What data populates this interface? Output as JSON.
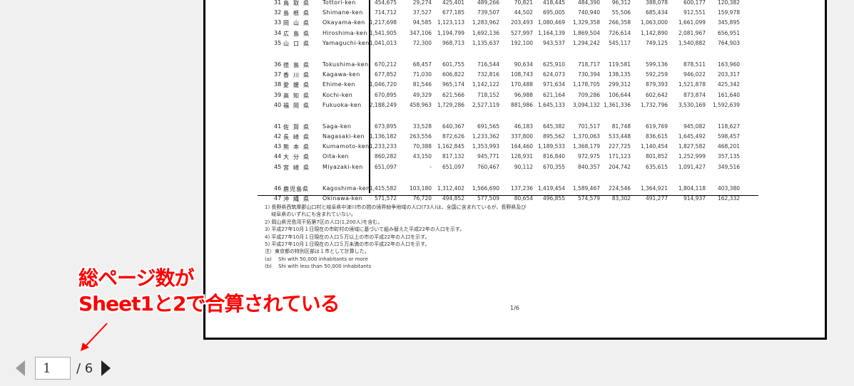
{
  "document": {
    "rows": [
      {
        "no": "31",
        "jp": "鳥取県",
        "en": "Tottori-ken",
        "values": [
          "454,675",
          "29,274",
          "425,401",
          "489,266",
          "70,821",
          "418,445",
          "484,390",
          "96,312",
          "388,078",
          "600,177",
          "120,382"
        ]
      },
      {
        "no": "32",
        "jp": "島根県",
        "en": "Shimane-ken",
        "values": [
          "714,712",
          "37,527",
          "677,185",
          "739,507",
          "44,502",
          "695,005",
          "740,940",
          "55,506",
          "685,434",
          "912,551",
          "159,978"
        ]
      },
      {
        "no": "33",
        "jp": "岡山県",
        "en": "Okayama-ken",
        "values": [
          "1,217,698",
          "94,585",
          "1,123,113",
          "1,283,962",
          "203,493",
          "1,080,469",
          "1,329,358",
          "266,358",
          "1,063,000",
          "1,661,099",
          "345,895"
        ]
      },
      {
        "no": "34",
        "jp": "広島県",
        "en": "Hiroshima-ken",
        "values": [
          "1,541,905",
          "347,106",
          "1,194,799",
          "1,692,136",
          "527,997",
          "1,164,139",
          "1,869,504",
          "726,614",
          "1,142,890",
          "2,081,967",
          "656,951"
        ]
      },
      {
        "no": "35",
        "jp": "山口県",
        "en": "Yamaguchi-ken",
        "values": [
          "1,041,013",
          "72,300",
          "968,713",
          "1,135,637",
          "192,100",
          "943,537",
          "1,294,242",
          "545,117",
          "749,125",
          "1,540,882",
          "764,903"
        ]
      },
      {
        "gap": true
      },
      {
        "no": "36",
        "jp": "徳島県",
        "en": "Tokushima-ken",
        "values": [
          "670,212",
          "68,457",
          "601,755",
          "716,544",
          "90,634",
          "625,910",
          "718,717",
          "119,581",
          "599,136",
          "878,511",
          "163,960"
        ]
      },
      {
        "no": "37",
        "jp": "香川県",
        "en": "Kagawa-ken",
        "values": [
          "677,852",
          "71,030",
          "606,822",
          "732,816",
          "108,743",
          "624,073",
          "730,394",
          "138,135",
          "592,259",
          "946,022",
          "203,317"
        ]
      },
      {
        "no": "38",
        "jp": "愛媛県",
        "en": "Ehime-ken",
        "values": [
          "1,046,720",
          "81,546",
          "965,174",
          "1,142,122",
          "170,488",
          "971,634",
          "1,178,705",
          "299,312",
          "879,393",
          "1,521,878",
          "425,342"
        ]
      },
      {
        "no": "39",
        "jp": "高知県",
        "en": "Kochi-ken",
        "values": [
          "670,895",
          "49,329",
          "621,566",
          "718,152",
          "96,988",
          "621,164",
          "709,286",
          "106,644",
          "602,642",
          "873,874",
          "161,640"
        ]
      },
      {
        "no": "40",
        "jp": "福岡県",
        "en": "Fukuoka-ken",
        "values": [
          "2,188,249",
          "458,963",
          "1,729,286",
          "2,527,119",
          "881,986",
          "1,645,133",
          "3,094,132",
          "1,361,336",
          "1,732,796",
          "3,530,169",
          "1,592,639"
        ]
      },
      {
        "gap": true
      },
      {
        "no": "41",
        "jp": "佐賀県",
        "en": "Saga-ken",
        "values": [
          "673,895",
          "33,528",
          "640,367",
          "691,565",
          "46,183",
          "645,382",
          "701,517",
          "81,748",
          "619,769",
          "945,082",
          "118,627"
        ]
      },
      {
        "no": "42",
        "jp": "長崎県",
        "en": "Nagasaki-ken",
        "values": [
          "1,136,182",
          "263,556",
          "872,626",
          "1,233,362",
          "337,800",
          "895,562",
          "1,370,063",
          "533,448",
          "836,615",
          "1,645,492",
          "598,457"
        ]
      },
      {
        "no": "43",
        "jp": "熊本県",
        "en": "Kumamoto-ken",
        "values": [
          "1,233,233",
          "70,388",
          "1,162,845",
          "1,353,993",
          "164,460",
          "1,189,533",
          "1,368,179",
          "227,725",
          "1,140,454",
          "1,827,582",
          "468,201"
        ]
      },
      {
        "no": "44",
        "jp": "大分県",
        "en": "Oita-ken",
        "values": [
          "860,282",
          "43,150",
          "817,132",
          "945,771",
          "128,931",
          "816,840",
          "972,975",
          "171,123",
          "801,852",
          "1,252,999",
          "357,135"
        ]
      },
      {
        "no": "45",
        "jp": "宮崎県",
        "en": "Miyazaki-ken",
        "values": [
          "651,097",
          "-",
          "651,097",
          "760,467",
          "90,112",
          "670,355",
          "840,357",
          "204,742",
          "635,615",
          "1,091,427",
          "349,516"
        ]
      },
      {
        "gap": true
      },
      {
        "no": "46",
        "jp": "鹿児島県",
        "en": "Kagoshima-ken",
        "values": [
          "1,415,582",
          "103,180",
          "1,312,402",
          "1,566,690",
          "137,236",
          "1,419,454",
          "1,589,467",
          "224,546",
          "1,364,921",
          "1,804,118",
          "403,380"
        ]
      },
      {
        "no": "47",
        "jp": "沖縄県",
        "en": "Okinawa-ken",
        "values": [
          "571,572",
          "76,720",
          "494,852",
          "577,509",
          "80,654",
          "496,855",
          "574,579",
          "83,302",
          "491,277",
          "914,937",
          "162,332"
        ]
      }
    ],
    "notes": [
      "1) 長野県西筑摩郡山口村と岐阜県中津川市の間の境界紛争地域の人口(73人)は、全国に含まれているが、長野県及び",
      "　 岐阜県のいずれにも含まれていない。",
      "2) 岡山県児島湾干拓第7区の人口(1,200人)を含む。",
      " 3) 平成27年10月１日現在の市町村の境域に基づいて組み替えた平成22年の人口を示す。",
      " 4) 平成27年10月１日現在の人口５万以上の市の平成22年の人口を示す。",
      " 5) 平成27年10月１日現在の人口５万未満の市の平成22年の人口を示す。",
      "注）東京都の特別区部は１市として計算した。",
      " (a)　 Shi with 50,000 inhabitants or more",
      " (b)　 Shi with less than 50,000 inhabitants"
    ],
    "page_footer": "1/6"
  },
  "annotation": {
    "line1": "総ページ数が",
    "line2": "Sheet1と2で合算されている",
    "color": "#ff0000"
  },
  "pager": {
    "current_page": "1",
    "total_label": "/ 6",
    "prev_icon": "triangle-left",
    "next_icon": "triangle-right"
  }
}
